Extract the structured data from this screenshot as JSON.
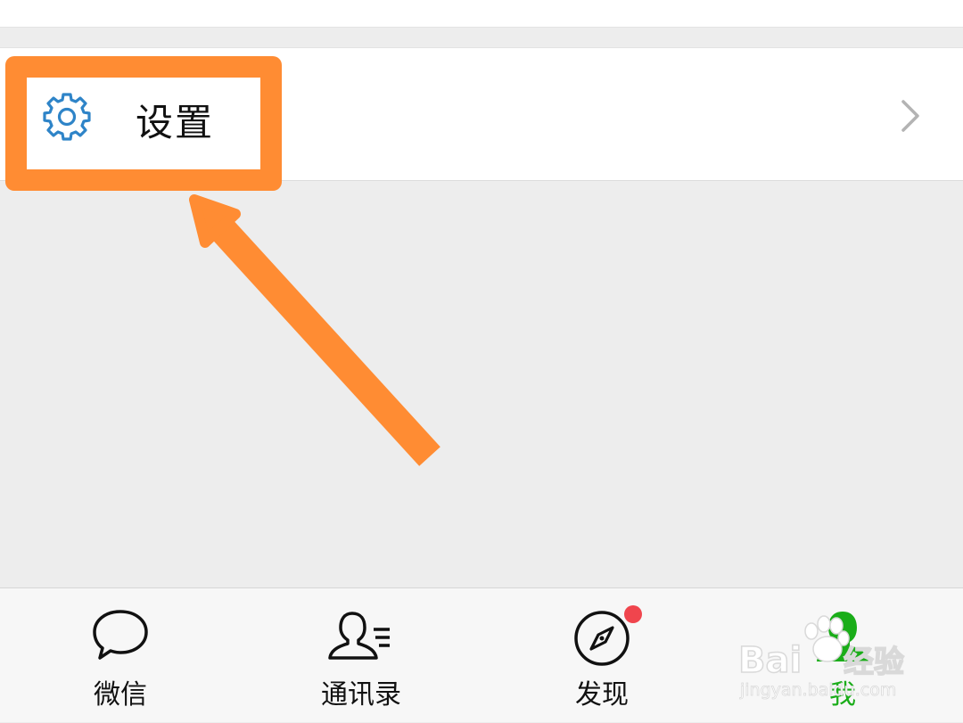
{
  "settings": {
    "label": "设置",
    "icon": "gear-icon",
    "icon_color": "#2e84c8"
  },
  "annotation": {
    "color": "#ff8c33"
  },
  "tabbar": {
    "tabs": [
      {
        "label": "微信",
        "icon": "chat-bubble-icon",
        "active": false
      },
      {
        "label": "通讯录",
        "icon": "contacts-icon",
        "active": false
      },
      {
        "label": "发现",
        "icon": "compass-icon",
        "active": false,
        "badge": "red-dot"
      },
      {
        "label": "我",
        "icon": "person-icon",
        "active": true
      }
    ],
    "active_color": "#1aad19"
  },
  "watermark": {
    "brand": "Bai",
    "brand_cn": "经验",
    "url": "jingyan.baidu.com"
  }
}
